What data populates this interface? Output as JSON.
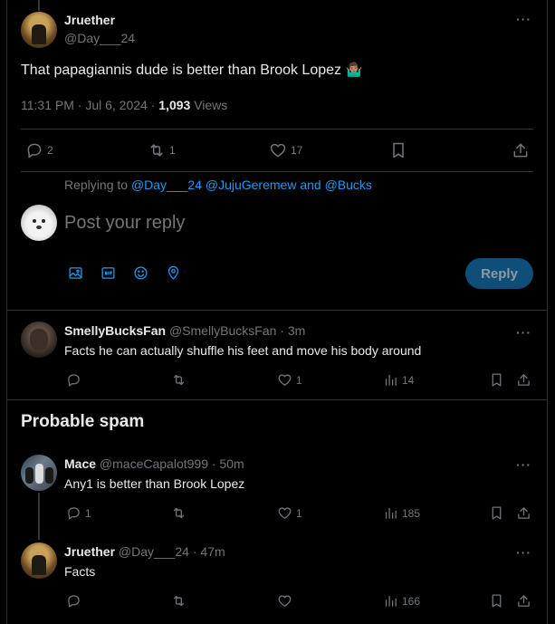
{
  "main_post": {
    "display_name": "Jruether",
    "handle": "@Day___24",
    "text": "That papagiannis dude is better than Brook Lopez",
    "emoji": "🤷🏽‍♂️",
    "timestamp": "11:31 PM · Jul 6, 2024 · ",
    "views_count": "1,093",
    "views_label": " Views",
    "replies": "2",
    "reposts": "1",
    "likes": "17"
  },
  "reply_box": {
    "replying_prefix": "Replying to ",
    "replying_to": "@Day___24 @JujuGeremew and @Bucks",
    "placeholder": "Post your reply",
    "reply_button": "Reply",
    "tools": [
      "image-icon",
      "gif-icon",
      "emoji-icon",
      "location-icon"
    ]
  },
  "replies": [
    {
      "display_name": "SmellyBucksFan",
      "handle": "@SmellyBucksFan · 3m",
      "text": "Facts he can actually shuffle his feet and move his body around",
      "replies": "",
      "reposts": "",
      "likes": "1",
      "views": "14"
    }
  ],
  "spam_section": {
    "heading": "Probable spam",
    "posts": [
      {
        "display_name": "Mace",
        "handle": "@maceCapalot999 · 50m",
        "text": "Any1 is better than Brook Lopez",
        "replies": "1",
        "reposts": "",
        "likes": "1",
        "views": "185"
      },
      {
        "display_name": "Jruether",
        "handle": "@Day___24 · 47m",
        "text": "Facts",
        "replies": "",
        "reposts": "",
        "likes": "",
        "views": "166"
      }
    ]
  },
  "colors": {
    "accent": "#1d9bf0",
    "reply_button_bg": "#0f4e78",
    "muted": "#71767b",
    "border": "#2f3336"
  }
}
